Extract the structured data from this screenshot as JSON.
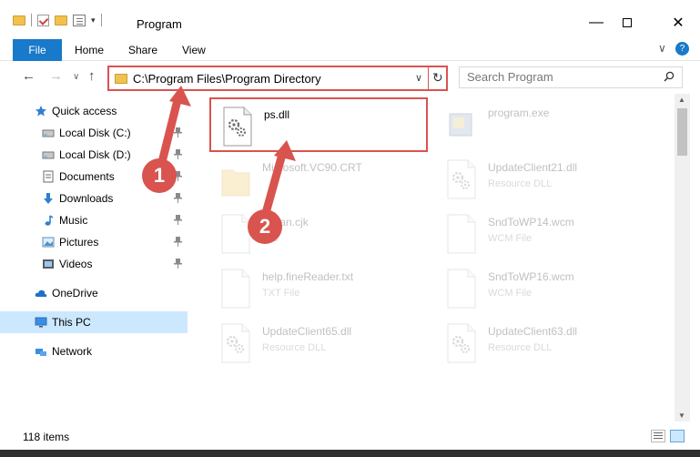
{
  "window": {
    "title": "Program",
    "minimize_label": "—",
    "close_label": "✕"
  },
  "ribbon": {
    "file": "File",
    "home": "Home",
    "share": "Share",
    "view": "View",
    "collapse": "∨",
    "help": "?"
  },
  "nav": {
    "back": "←",
    "forward": "→",
    "recent": "∨",
    "up": "↑",
    "address": "C:\\Program Files\\Program Directory",
    "address_dropdown": "∨",
    "refresh": "↻",
    "search_placeholder": "Search Program"
  },
  "sidebar": {
    "items": [
      {
        "label": "Quick access",
        "icon": "star-icon",
        "pinned": false
      },
      {
        "label": "Local Disk (C:)",
        "icon": "drive-icon",
        "pinned": true
      },
      {
        "label": "Local Disk (D:)",
        "icon": "drive-icon",
        "pinned": true
      },
      {
        "label": "Documents",
        "icon": "documents-icon",
        "pinned": true
      },
      {
        "label": "Downloads",
        "icon": "download-icon",
        "pinned": true
      },
      {
        "label": "Music",
        "icon": "music-icon",
        "pinned": true
      },
      {
        "label": "Pictures",
        "icon": "pictures-icon",
        "pinned": true
      },
      {
        "label": "Videos",
        "icon": "videos-icon",
        "pinned": true
      },
      {
        "label": "OneDrive",
        "icon": "cloud-icon",
        "pinned": false
      },
      {
        "label": "This PC",
        "icon": "computer-icon",
        "pinned": false,
        "selected": true
      },
      {
        "label": "Network",
        "icon": "network-icon",
        "pinned": false
      }
    ],
    "pin_glyph": "📌"
  },
  "files": [
    {
      "name": "ps.dll",
      "type": "",
      "icon": "dll-icon",
      "highlighted": true
    },
    {
      "name": "program.exe",
      "type": "",
      "icon": "exe-icon"
    },
    {
      "name": "Microsoft.VC90.CRT",
      "type": "",
      "icon": "folder-icon"
    },
    {
      "name": "UpdateClient21.dll",
      "type": "Resource DLL",
      "icon": "dll-icon"
    },
    {
      "name": "eacan.cjk",
      "type": "File",
      "icon": "file-icon"
    },
    {
      "name": "SndToWP14.wcm",
      "type": "WCM File",
      "icon": "file-icon"
    },
    {
      "name": "help.fineReader.txt",
      "type": "TXT File",
      "icon": "file-icon"
    },
    {
      "name": "SndToWP16.wcm",
      "type": "WCM File",
      "icon": "file-icon"
    },
    {
      "name": "UpdateClient65.dll",
      "type": "Resource DLL",
      "icon": "dll-icon"
    },
    {
      "name": "UpdateClient63.dll",
      "type": "Resource DLL",
      "icon": "dll-icon"
    }
  ],
  "status": {
    "item_count": "118 items"
  },
  "annotations": {
    "marker1": "1",
    "marker2": "2",
    "color": "#d9534f"
  }
}
